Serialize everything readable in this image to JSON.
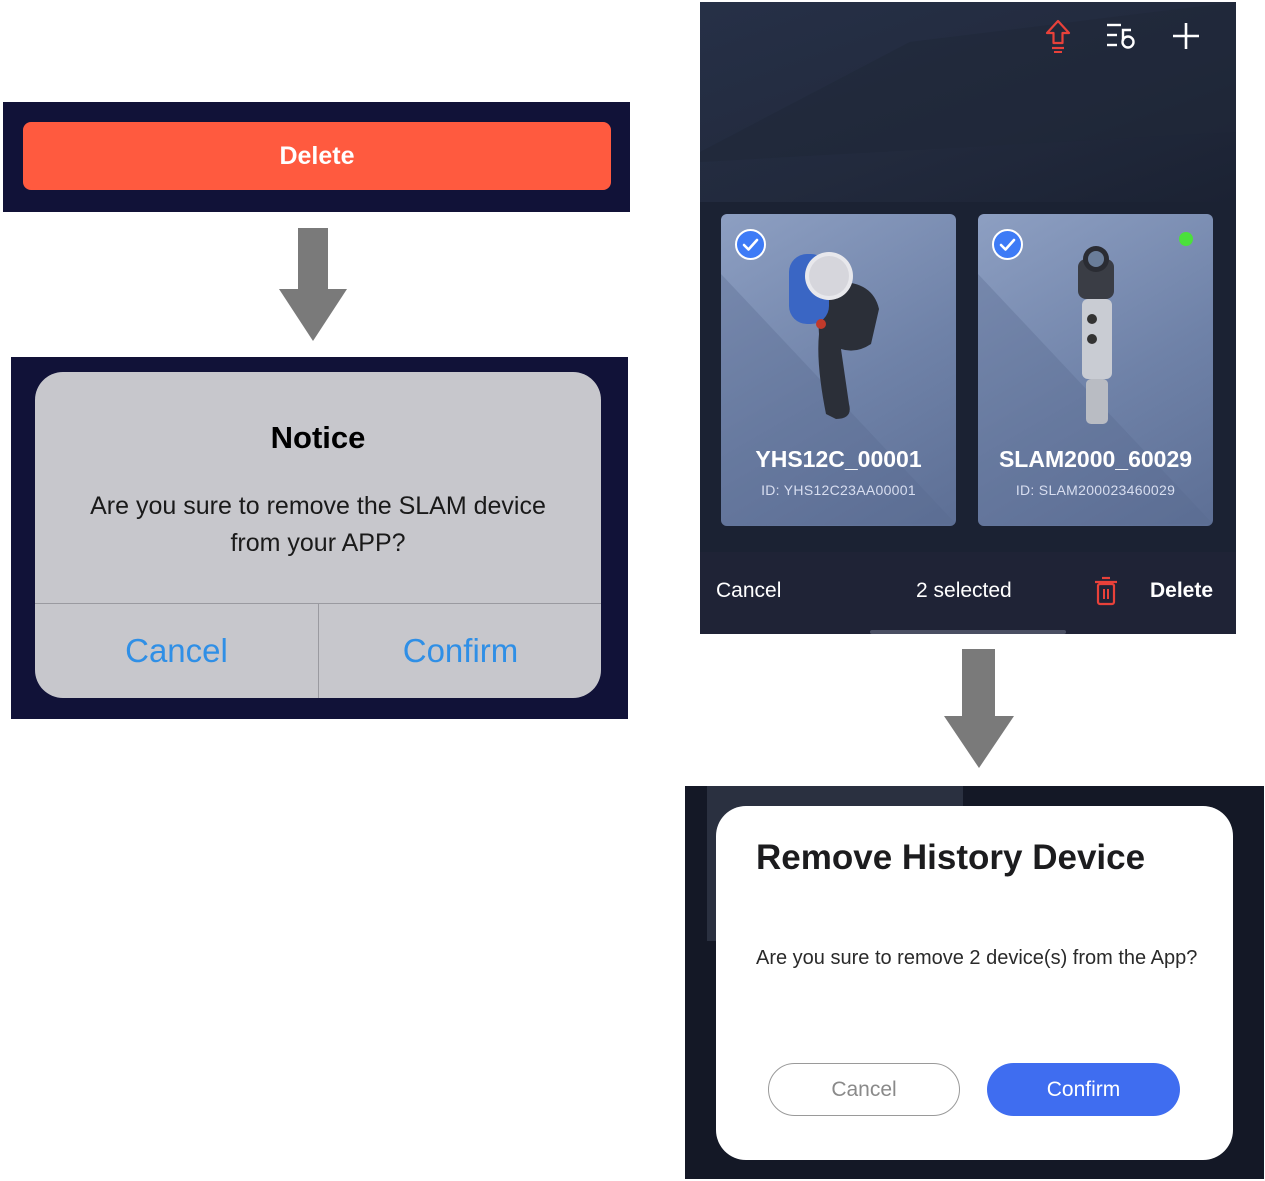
{
  "delete_panel": {
    "button_label": "Delete"
  },
  "notice_dialog": {
    "title": "Notice",
    "message": "Are you sure to remove the SLAM device from your APP?",
    "cancel_label": "Cancel",
    "confirm_label": "Confirm"
  },
  "device_screen": {
    "top_icons": [
      "upload-icon",
      "filter-list-icon",
      "plus-icon"
    ],
    "devices": [
      {
        "name": "YHS12C_00001",
        "id": "ID: YHS12C23AA00001",
        "selected": true,
        "online": false
      },
      {
        "name": "SLAM2000_60029",
        "id": "ID: SLAM200023460029",
        "selected": true,
        "online": true
      }
    ],
    "bottom_bar": {
      "cancel_label": "Cancel",
      "selected_text": "2 selected",
      "delete_label": "Delete"
    }
  },
  "remove_dialog": {
    "title": "Remove History Device",
    "message": "Are you sure to remove 2 device(s) from the App?",
    "cancel_label": "Cancel",
    "confirm_label": "Confirm"
  },
  "colors": {
    "delete_red": "#ff5a3f",
    "ios_blue": "#2f8fe6",
    "confirm_blue": "#3f6df0",
    "check_blue": "#3e7bf6",
    "online_green": "#4be03b",
    "trash_red": "#e8413a"
  }
}
